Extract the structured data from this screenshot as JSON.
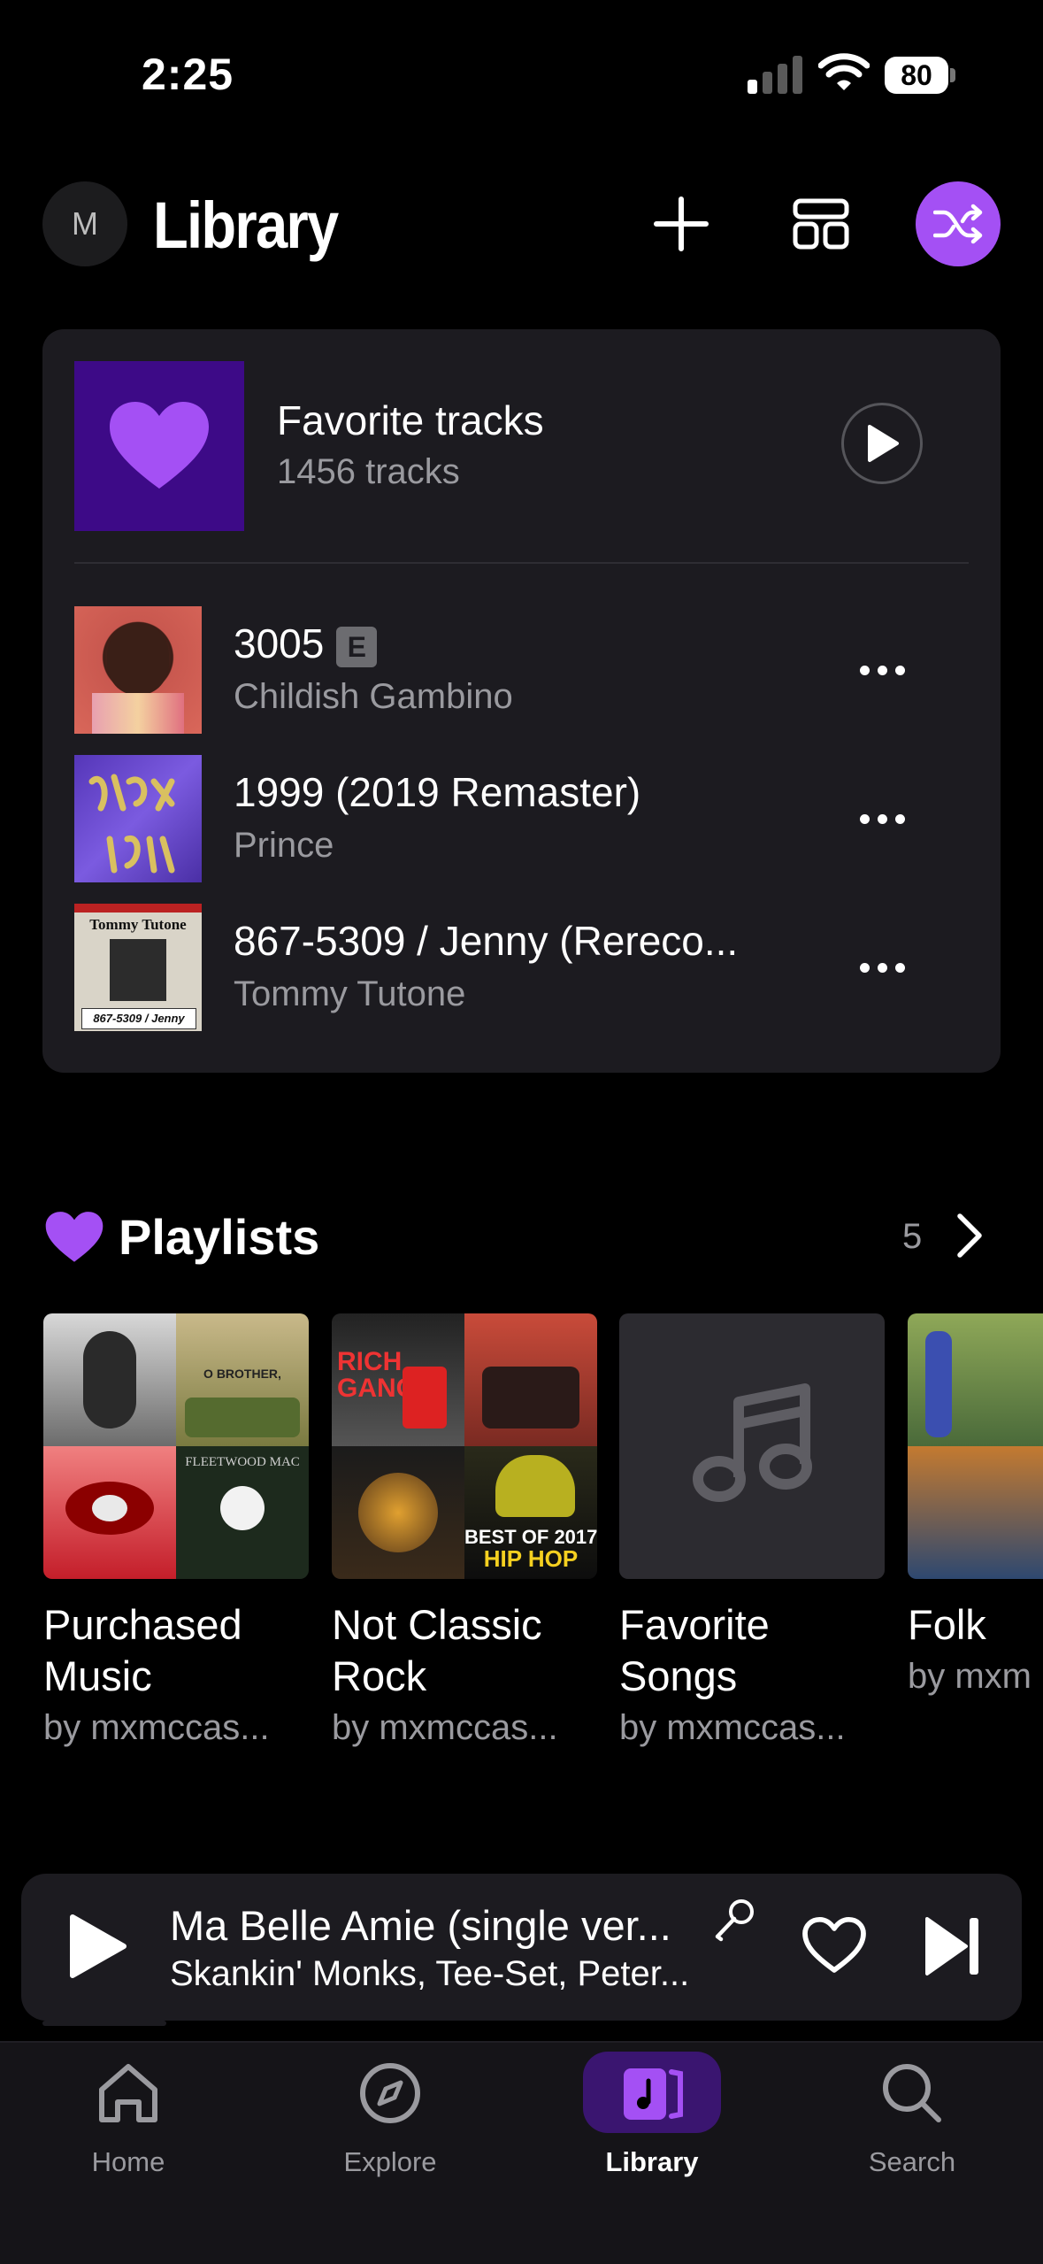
{
  "status_bar": {
    "time": "2:25",
    "battery": "80"
  },
  "header": {
    "avatar_initial": "M",
    "title": "Library"
  },
  "favorites": {
    "title": "Favorite tracks",
    "count": "1456 tracks"
  },
  "tracks": [
    {
      "title": "3005",
      "explicit": "E",
      "artist": "Childish Gambino"
    },
    {
      "title": "1999 (2019 Remaster)",
      "artist": "Prince"
    },
    {
      "title": "867-5309 / Jenny (Rereco...",
      "artist": "Tommy Tutone",
      "art_text_top": "Tommy Tutone",
      "art_text_bottom": "867-5309 / Jenny"
    }
  ],
  "playlists": {
    "title": "Playlists",
    "count": "5",
    "items": [
      {
        "name": "Purchased Music",
        "owner": "by mxmccas...",
        "cover_texts": [
          "O BROTHER,",
          "FLEETWOOD MAC"
        ]
      },
      {
        "name": "Not Classic Rock",
        "owner": "by mxmccas...",
        "cover_texts": [
          "RICH GANG",
          "BEST OF 2017",
          "HIP HOP"
        ]
      },
      {
        "name": "Favorite Songs",
        "owner": "by mxmccas..."
      },
      {
        "name": "Folk",
        "owner": "by mxm"
      }
    ]
  },
  "now_playing": {
    "title": "Ma Belle Amie (single ver...",
    "artist": "Skankin' Monks, Tee-Set, Peter..."
  },
  "tabs": [
    {
      "label": "Home"
    },
    {
      "label": "Explore"
    },
    {
      "label": "Library",
      "active": true
    },
    {
      "label": "Search"
    }
  ],
  "colors": {
    "accent": "#a450f4",
    "card": "#1c1b20",
    "fav_art": "#3d0a87"
  }
}
